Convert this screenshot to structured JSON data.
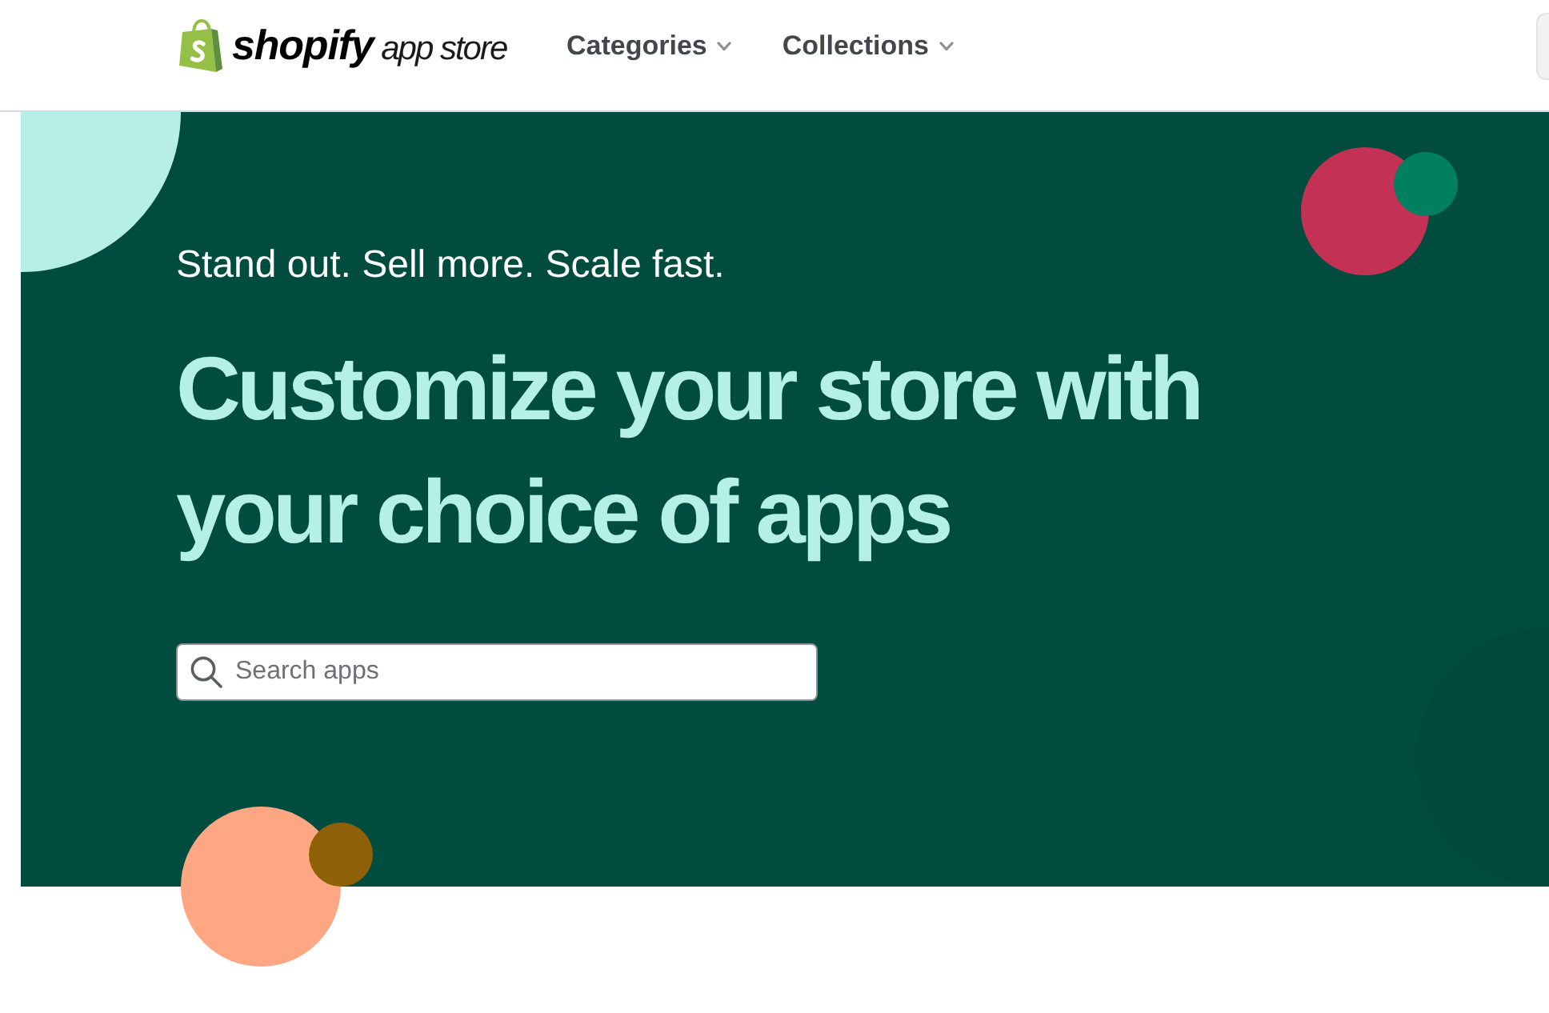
{
  "header": {
    "logo": {
      "wordmark": "**shopify** app store"
    },
    "nav": [
      {
        "label": "Categories",
        "dropdown": true
      },
      {
        "label": "Collections",
        "dropdown": true
      }
    ]
  },
  "hero": {
    "tagline": "Stand out. Sell more. Scale fast.",
    "headline": "Customize your store with your choice of apps",
    "search": {
      "placeholder": "Search apps"
    }
  }
}
